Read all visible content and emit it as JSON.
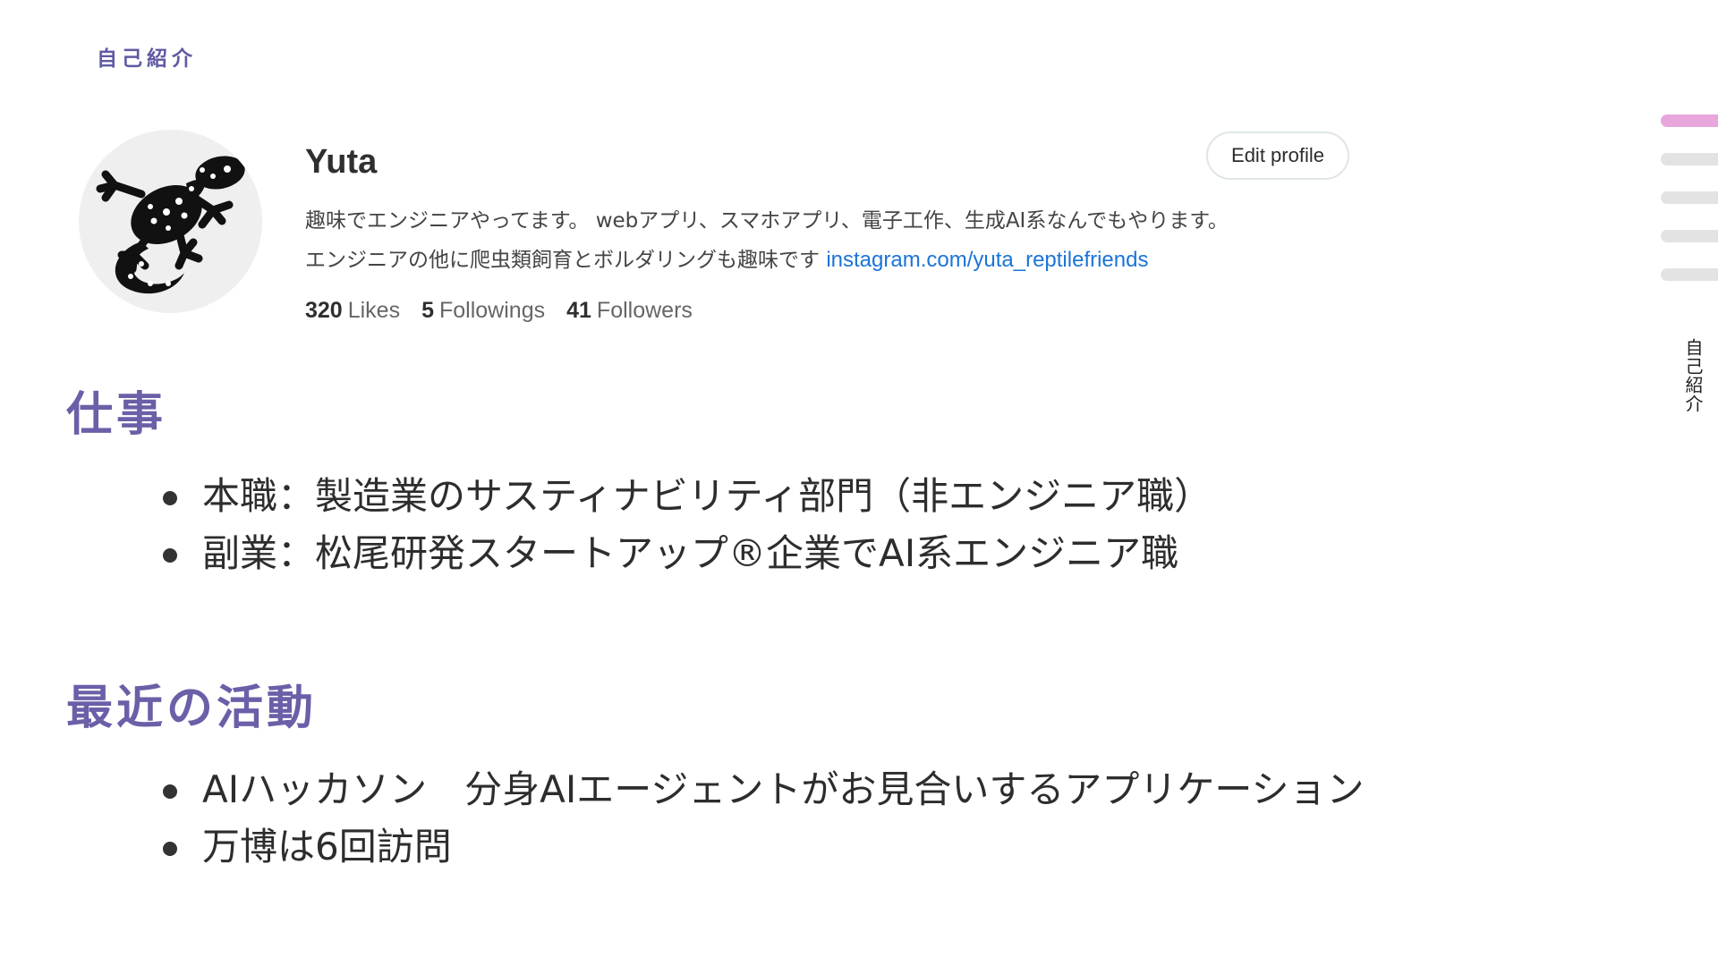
{
  "header": {
    "section_label": "自己紹介"
  },
  "profile": {
    "name": "Yuta",
    "edit_button": "Edit profile",
    "bio_line1": "趣味でエンジニアやってます。 webアプリ、スマホアプリ、電子工作、生成AI系なんでもやります。",
    "bio_line2": "エンジニアの他に爬虫類飼育とボルダリングも趣味です",
    "bio_link": "instagram.com/yuta_reptilefriends",
    "avatar_icon": "gecko-icon",
    "stats": [
      {
        "count": "320",
        "label": "Likes"
      },
      {
        "count": "5",
        "label": "Followings"
      },
      {
        "count": "41",
        "label": "Followers"
      }
    ]
  },
  "work": {
    "heading": "仕事",
    "items": [
      "本職：製造業のサスティナビリティ部門（非エンジニア職）",
      "副業：松尾研発スタートアップ®企業でAI系エンジニア職"
    ]
  },
  "recent": {
    "heading": "最近の活動",
    "items": [
      "AIハッカソン　分身AIエージェントがお見合いするアプリケーション",
      "万博は6回訪問"
    ]
  },
  "side_nav": {
    "label": "自己紹介",
    "active_index": 0,
    "active_color": "#e8a6dd",
    "inactive_color": "#e3e3e3"
  },
  "colors": {
    "heading": "#6b5fa8",
    "link": "#1b74d8"
  }
}
